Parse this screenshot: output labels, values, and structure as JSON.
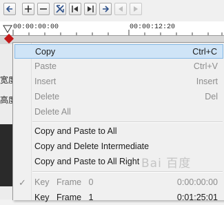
{
  "toolbar": {
    "buttons": [
      {
        "icon": "arrow-left-icon",
        "enabled": true
      },
      {
        "icon": "plus-icon",
        "enabled": true
      },
      {
        "icon": "minus-icon",
        "enabled": true
      },
      {
        "icon": "swap-icon",
        "enabled": true
      },
      {
        "icon": "prev-keyframe-icon",
        "enabled": true
      },
      {
        "icon": "next-keyframe-icon",
        "enabled": true
      },
      {
        "icon": "arrow-right-icon",
        "enabled": true
      },
      {
        "icon": "diamond-left-icon",
        "enabled": false
      },
      {
        "icon": "diamond-right-icon",
        "enabled": false
      }
    ]
  },
  "ruler": {
    "start_time": "00:00:00:00",
    "mid_time": "00:00:12:20"
  },
  "left_panel": {
    "label_1": "宽度",
    "label_2": "高度"
  },
  "menu": {
    "copy": {
      "label": "Copy",
      "shortcut": "Ctrl+C"
    },
    "paste": {
      "label": "Paste",
      "shortcut": "Ctrl+V"
    },
    "insert": {
      "label": "Insert",
      "shortcut": "Insert"
    },
    "delete": {
      "label": "Delete",
      "shortcut": "Del"
    },
    "delete_all": {
      "label": "Delete All"
    },
    "copy_paste_all": {
      "label": "Copy and Paste to All"
    },
    "copy_delete_intermediate": {
      "label": "Copy and Delete Intermediate"
    },
    "copy_paste_all_right": {
      "label": "Copy and Paste to All Right"
    },
    "keyframes": [
      {
        "name": "Key   Frame   0",
        "time": "0:00:00:00",
        "checked": true
      },
      {
        "name": "Key   Frame   1",
        "time": "0:01:25:01",
        "checked": false
      }
    ]
  },
  "watermark": "Bai 百度"
}
